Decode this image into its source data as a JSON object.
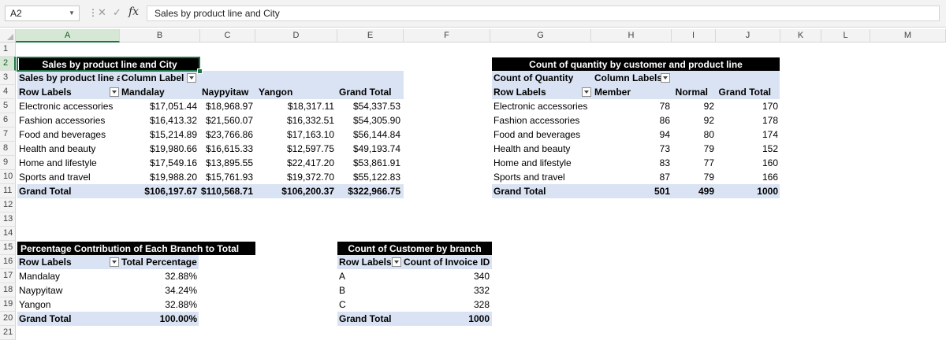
{
  "formula_bar": {
    "name_box": "A2",
    "formula": "Sales by product line and City",
    "fx_label": "fx"
  },
  "columns": [
    "A",
    "B",
    "C",
    "D",
    "E",
    "F",
    "G",
    "H",
    "I",
    "J",
    "K",
    "L",
    "M"
  ],
  "rows": [
    "1",
    "2",
    "3",
    "4",
    "5",
    "6",
    "7",
    "8",
    "9",
    "10",
    "11",
    "12",
    "13",
    "14",
    "15",
    "16",
    "17",
    "18",
    "19",
    "20",
    "21"
  ],
  "pivot_sales": {
    "title": "Sales by product line and City",
    "corner_label": "Sales by product line and City",
    "column_labels": "Column Labels",
    "row_labels": "Row Labels",
    "headers": [
      "Mandalay",
      "Naypyitaw",
      "Yangon",
      "Grand Total"
    ],
    "rows": [
      {
        "label": "Electronic accessories",
        "values": [
          "$17,051.44",
          "$18,968.97",
          "$18,317.11",
          "$54,337.53"
        ]
      },
      {
        "label": "Fashion accessories",
        "values": [
          "$16,413.32",
          "$21,560.07",
          "$16,332.51",
          "$54,305.90"
        ]
      },
      {
        "label": "Food and beverages",
        "values": [
          "$15,214.89",
          "$23,766.86",
          "$17,163.10",
          "$56,144.84"
        ]
      },
      {
        "label": "Health and beauty",
        "values": [
          "$19,980.66",
          "$16,615.33",
          "$12,597.75",
          "$49,193.74"
        ]
      },
      {
        "label": "Home and lifestyle",
        "values": [
          "$17,549.16",
          "$13,895.55",
          "$22,417.20",
          "$53,861.91"
        ]
      },
      {
        "label": "Sports and travel",
        "values": [
          "$19,988.20",
          "$15,761.93",
          "$19,372.70",
          "$55,122.83"
        ]
      }
    ],
    "total": {
      "label": "Grand Total",
      "values": [
        "$106,197.67",
        "$110,568.71",
        "$106,200.37",
        "$322,966.75"
      ]
    }
  },
  "pivot_quantity": {
    "title": "Count of quantity by customer and product line",
    "corner_label": "Count of Quantity",
    "column_labels": "Column Labels",
    "row_labels": "Row Labels",
    "headers": [
      "Member",
      "Normal",
      "Grand Total"
    ],
    "rows": [
      {
        "label": "Electronic accessories",
        "values": [
          "78",
          "92",
          "170"
        ]
      },
      {
        "label": "Fashion accessories",
        "values": [
          "86",
          "92",
          "178"
        ]
      },
      {
        "label": "Food and beverages",
        "values": [
          "94",
          "80",
          "174"
        ]
      },
      {
        "label": "Health and beauty",
        "values": [
          "73",
          "79",
          "152"
        ]
      },
      {
        "label": "Home and lifestyle",
        "values": [
          "83",
          "77",
          "160"
        ]
      },
      {
        "label": "Sports and travel",
        "values": [
          "87",
          "79",
          "166"
        ]
      }
    ],
    "total": {
      "label": "Grand Total",
      "values": [
        "501",
        "499",
        "1000"
      ]
    }
  },
  "pivot_branch_pct": {
    "title": "Percentage Contribution of Each Branch to Total Sales",
    "row_labels": "Row Labels",
    "value_header": "Total Percentage",
    "rows": [
      {
        "label": "Mandalay",
        "value": "32.88%"
      },
      {
        "label": "Naypyitaw",
        "value": "34.24%"
      },
      {
        "label": "Yangon",
        "value": "32.88%"
      }
    ],
    "total": {
      "label": "Grand Total",
      "value": "100.00%"
    }
  },
  "pivot_customer_branch": {
    "title": "Count of Customer by branch",
    "row_labels": "Row Labels",
    "value_header": "Count of Invoice ID",
    "rows": [
      {
        "label": "A",
        "value": "340"
      },
      {
        "label": "B",
        "value": "332"
      },
      {
        "label": "C",
        "value": "328"
      }
    ],
    "total": {
      "label": "Grand Total",
      "value": "1000"
    }
  }
}
